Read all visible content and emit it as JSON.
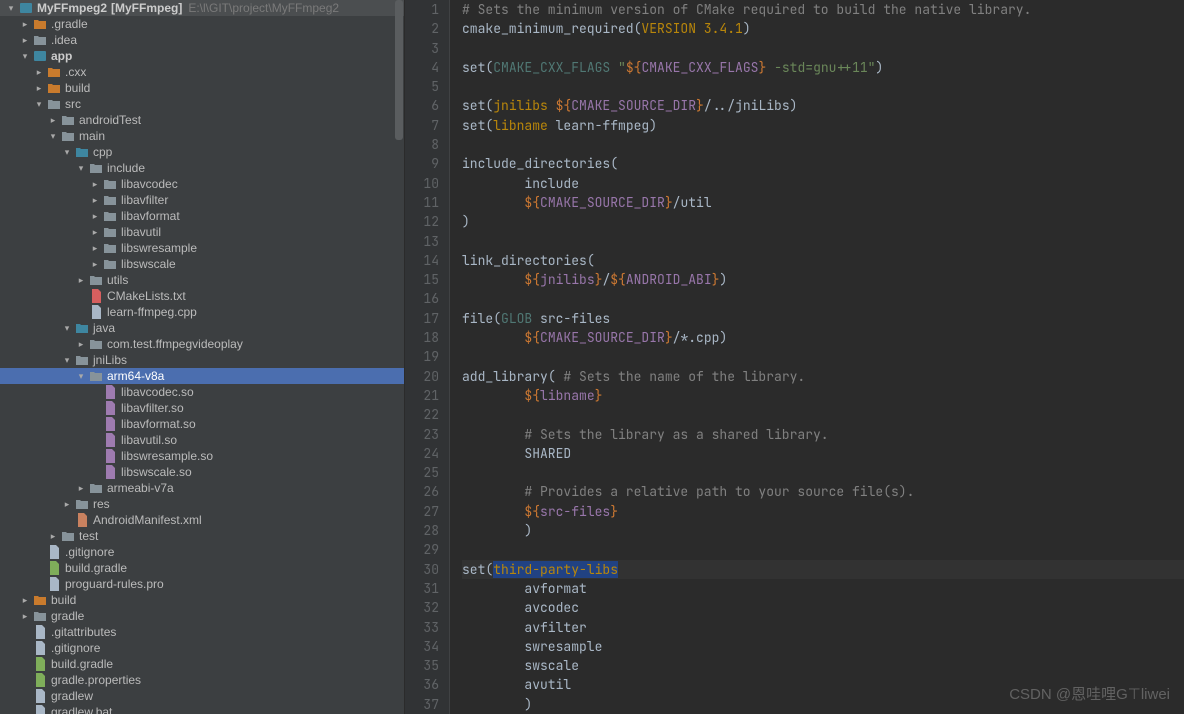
{
  "project": {
    "root_name": "MyFFmpeg2",
    "root_bracket": "[MyFFmpeg]",
    "root_path": "E:\\l\\GIT\\project\\MyFFmpeg2",
    "tree": [
      {
        "depth": 0,
        "arrow": "down",
        "icon": "module",
        "label": "MyFFmpeg2",
        "extra_bracket": "[MyFFmpeg]",
        "extra_path": "E:\\l\\GIT\\project\\MyFFmpeg2",
        "bold": true
      },
      {
        "depth": 1,
        "arrow": "right",
        "icon": "folder-orange",
        "label": ".gradle"
      },
      {
        "depth": 1,
        "arrow": "right",
        "icon": "folder",
        "label": ".idea"
      },
      {
        "depth": 1,
        "arrow": "down",
        "icon": "module",
        "label": "app",
        "bold": true
      },
      {
        "depth": 2,
        "arrow": "right",
        "icon": "folder-orange",
        "label": ".cxx"
      },
      {
        "depth": 2,
        "arrow": "right",
        "icon": "folder-orange",
        "label": "build"
      },
      {
        "depth": 2,
        "arrow": "down",
        "icon": "folder",
        "label": "src"
      },
      {
        "depth": 3,
        "arrow": "right",
        "icon": "folder",
        "label": "androidTest"
      },
      {
        "depth": 3,
        "arrow": "down",
        "icon": "folder",
        "label": "main"
      },
      {
        "depth": 4,
        "arrow": "down",
        "icon": "folder-blue",
        "label": "cpp"
      },
      {
        "depth": 5,
        "arrow": "down",
        "icon": "folder",
        "label": "include"
      },
      {
        "depth": 6,
        "arrow": "right",
        "icon": "folder",
        "label": "libavcodec"
      },
      {
        "depth": 6,
        "arrow": "right",
        "icon": "folder",
        "label": "libavfilter"
      },
      {
        "depth": 6,
        "arrow": "right",
        "icon": "folder",
        "label": "libavformat"
      },
      {
        "depth": 6,
        "arrow": "right",
        "icon": "folder",
        "label": "libavutil"
      },
      {
        "depth": 6,
        "arrow": "right",
        "icon": "folder",
        "label": "libswresample"
      },
      {
        "depth": 6,
        "arrow": "right",
        "icon": "folder",
        "label": "libswscale"
      },
      {
        "depth": 5,
        "arrow": "right",
        "icon": "folder",
        "label": "utils"
      },
      {
        "depth": 5,
        "arrow": "none",
        "icon": "cmake",
        "label": "CMakeLists.txt"
      },
      {
        "depth": 5,
        "arrow": "none",
        "icon": "cpp",
        "label": "learn-ffmpeg.cpp"
      },
      {
        "depth": 4,
        "arrow": "down",
        "icon": "folder-blue",
        "label": "java"
      },
      {
        "depth": 5,
        "arrow": "right",
        "icon": "folder",
        "label": "com.test.ffmpegvideoplay"
      },
      {
        "depth": 4,
        "arrow": "down",
        "icon": "folder",
        "label": "jniLibs"
      },
      {
        "depth": 5,
        "arrow": "down",
        "icon": "folder",
        "label": "arm64-v8a",
        "selected": true
      },
      {
        "depth": 6,
        "arrow": "none",
        "icon": "so",
        "label": "libavcodec.so"
      },
      {
        "depth": 6,
        "arrow": "none",
        "icon": "so",
        "label": "libavfilter.so"
      },
      {
        "depth": 6,
        "arrow": "none",
        "icon": "so",
        "label": "libavformat.so"
      },
      {
        "depth": 6,
        "arrow": "none",
        "icon": "so",
        "label": "libavutil.so"
      },
      {
        "depth": 6,
        "arrow": "none",
        "icon": "so",
        "label": "libswresample.so"
      },
      {
        "depth": 6,
        "arrow": "none",
        "icon": "so",
        "label": "libswscale.so"
      },
      {
        "depth": 5,
        "arrow": "right",
        "icon": "folder",
        "label": "armeabi-v7a"
      },
      {
        "depth": 4,
        "arrow": "right",
        "icon": "folder",
        "label": "res"
      },
      {
        "depth": 4,
        "arrow": "none",
        "icon": "xml",
        "label": "AndroidManifest.xml"
      },
      {
        "depth": 3,
        "arrow": "right",
        "icon": "folder",
        "label": "test"
      },
      {
        "depth": 2,
        "arrow": "none",
        "icon": "file",
        "label": ".gitignore"
      },
      {
        "depth": 2,
        "arrow": "none",
        "icon": "gradle",
        "label": "build.gradle"
      },
      {
        "depth": 2,
        "arrow": "none",
        "icon": "file",
        "label": "proguard-rules.pro"
      },
      {
        "depth": 1,
        "arrow": "right",
        "icon": "folder-orange",
        "label": "build"
      },
      {
        "depth": 1,
        "arrow": "right",
        "icon": "folder",
        "label": "gradle"
      },
      {
        "depth": 1,
        "arrow": "none",
        "icon": "file",
        "label": ".gitattributes"
      },
      {
        "depth": 1,
        "arrow": "none",
        "icon": "file",
        "label": ".gitignore"
      },
      {
        "depth": 1,
        "arrow": "none",
        "icon": "gradle",
        "label": "build.gradle"
      },
      {
        "depth": 1,
        "arrow": "none",
        "icon": "gradle",
        "label": "gradle.properties"
      },
      {
        "depth": 1,
        "arrow": "none",
        "icon": "file",
        "label": "gradlew"
      },
      {
        "depth": 1,
        "arrow": "none",
        "icon": "file",
        "label": "gradlew.bat"
      }
    ]
  },
  "editor": {
    "first_line": 1,
    "cursor_line": 30,
    "lines": [
      [
        {
          "t": "# Sets the minimum version of CMake required to build the native library.",
          "c": "c-comment"
        }
      ],
      [
        {
          "t": "cmake_minimum_required",
          "c": "c-func"
        },
        {
          "t": "(",
          "c": "c-punc"
        },
        {
          "t": "VERSION 3.4.1",
          "c": "c-setarg"
        },
        {
          "t": ")",
          "c": "c-punc"
        }
      ],
      [],
      [
        {
          "t": "set",
          "c": "c-func"
        },
        {
          "t": "(",
          "c": "c-punc"
        },
        {
          "t": "CMAKE_CXX_FLAGS ",
          "c": "c-target"
        },
        {
          "t": "\"",
          "c": "c-str"
        },
        {
          "t": "${",
          "c": "c-varref"
        },
        {
          "t": "CMAKE_CXX_FLAGS",
          "c": "c-cmakevar"
        },
        {
          "t": "}",
          "c": "c-varref"
        },
        {
          "t": " -std=gnu++11\"",
          "c": "c-str"
        },
        {
          "t": ")",
          "c": "c-punc"
        }
      ],
      [],
      [
        {
          "t": "set",
          "c": "c-func"
        },
        {
          "t": "(",
          "c": "c-punc"
        },
        {
          "t": "jnilibs ",
          "c": "c-setarg"
        },
        {
          "t": "${",
          "c": "c-varref"
        },
        {
          "t": "CMAKE_SOURCE_DIR",
          "c": "c-cmakevar"
        },
        {
          "t": "}",
          "c": "c-varref"
        },
        {
          "t": "/../jniLibs",
          "c": "c-path"
        },
        {
          "t": ")",
          "c": "c-punc"
        }
      ],
      [
        {
          "t": "set",
          "c": "c-func"
        },
        {
          "t": "(",
          "c": "c-punc"
        },
        {
          "t": "libname ",
          "c": "c-setarg"
        },
        {
          "t": "learn-ffmpeg",
          "c": "c-ident"
        },
        {
          "t": ")",
          "c": "c-punc"
        }
      ],
      [],
      [
        {
          "t": "include_directories",
          "c": "c-func"
        },
        {
          "t": "(",
          "c": "c-punc"
        }
      ],
      [
        {
          "t": "        include",
          "c": "c-ident"
        }
      ],
      [
        {
          "t": "        ",
          "c": ""
        },
        {
          "t": "${",
          "c": "c-varref"
        },
        {
          "t": "CMAKE_SOURCE_DIR",
          "c": "c-cmakevar"
        },
        {
          "t": "}",
          "c": "c-varref"
        },
        {
          "t": "/util",
          "c": "c-path"
        }
      ],
      [
        {
          "t": ")",
          "c": "c-punc"
        }
      ],
      [],
      [
        {
          "t": "link_directories",
          "c": "c-func"
        },
        {
          "t": "(",
          "c": "c-punc"
        }
      ],
      [
        {
          "t": "        ",
          "c": ""
        },
        {
          "t": "${",
          "c": "c-varref"
        },
        {
          "t": "jnilibs",
          "c": "c-cmakevar"
        },
        {
          "t": "}",
          "c": "c-varref"
        },
        {
          "t": "/",
          "c": "c-path"
        },
        {
          "t": "${",
          "c": "c-varref"
        },
        {
          "t": "ANDROID_ABI",
          "c": "c-cmakevar"
        },
        {
          "t": "}",
          "c": "c-varref"
        },
        {
          "t": ")",
          "c": "c-punc"
        }
      ],
      [],
      [
        {
          "t": "file",
          "c": "c-func"
        },
        {
          "t": "(",
          "c": "c-punc"
        },
        {
          "t": "GLOB ",
          "c": "c-target"
        },
        {
          "t": "src-files",
          "c": "c-ident"
        }
      ],
      [
        {
          "t": "        ",
          "c": ""
        },
        {
          "t": "${",
          "c": "c-varref"
        },
        {
          "t": "CMAKE_SOURCE_DIR",
          "c": "c-cmakevar"
        },
        {
          "t": "}",
          "c": "c-varref"
        },
        {
          "t": "/*.cpp",
          "c": "c-path"
        },
        {
          "t": ")",
          "c": "c-punc"
        }
      ],
      [],
      [
        {
          "t": "add_library",
          "c": "c-func"
        },
        {
          "t": "( ",
          "c": "c-punc"
        },
        {
          "t": "# Sets the name of the library.",
          "c": "c-comment"
        }
      ],
      [
        {
          "t": "        ",
          "c": ""
        },
        {
          "t": "${",
          "c": "c-varref"
        },
        {
          "t": "libname",
          "c": "c-cmakevar"
        },
        {
          "t": "}",
          "c": "c-varref"
        }
      ],
      [],
      [
        {
          "t": "        ",
          "c": ""
        },
        {
          "t": "# Sets the library as a shared library.",
          "c": "c-comment"
        }
      ],
      [
        {
          "t": "        SHARED",
          "c": "c-ident"
        }
      ],
      [],
      [
        {
          "t": "        ",
          "c": ""
        },
        {
          "t": "# Provides a relative path to your source file(s).",
          "c": "c-comment"
        }
      ],
      [
        {
          "t": "        ",
          "c": ""
        },
        {
          "t": "${",
          "c": "c-varref"
        },
        {
          "t": "src-files",
          "c": "c-cmakevar"
        },
        {
          "t": "}",
          "c": "c-varref"
        }
      ],
      [
        {
          "t": "        )",
          "c": "c-punc"
        }
      ],
      [],
      [
        {
          "t": "set",
          "c": "c-func"
        },
        {
          "t": "(",
          "c": "c-punc"
        },
        {
          "t": "third-party-libs",
          "c": "c-setarg",
          "sel": true
        }
      ],
      [
        {
          "t": "        avformat",
          "c": "c-ident"
        }
      ],
      [
        {
          "t": "        avcodec",
          "c": "c-ident"
        }
      ],
      [
        {
          "t": "        avfilter",
          "c": "c-ident"
        }
      ],
      [
        {
          "t": "        swresample",
          "c": "c-ident"
        }
      ],
      [
        {
          "t": "        swscale",
          "c": "c-ident"
        }
      ],
      [
        {
          "t": "        avutil",
          "c": "c-ident"
        }
      ],
      [
        {
          "t": "        )",
          "c": "c-punc"
        }
      ]
    ]
  },
  "watermark": "CSDN @恩哇哩G⊤liwei"
}
